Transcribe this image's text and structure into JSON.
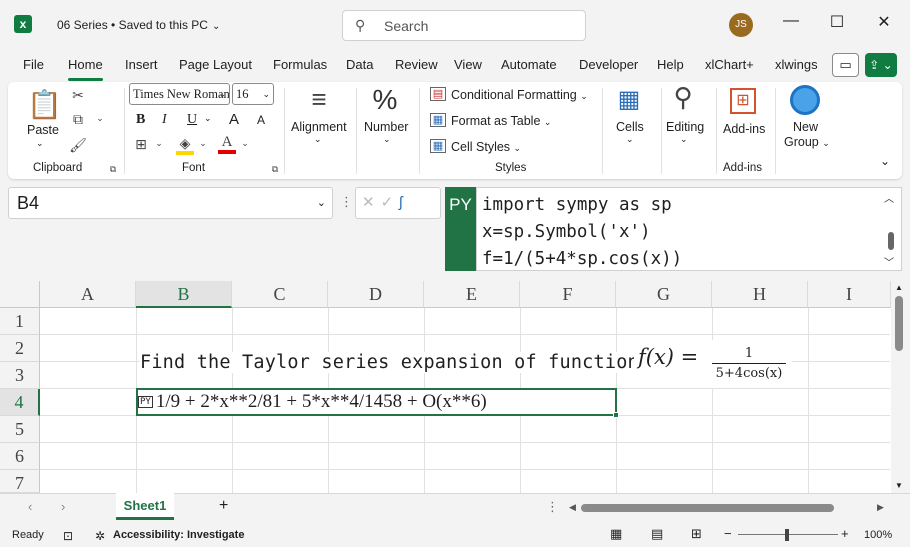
{
  "window": {
    "title": "06 Series • Saved to this PC",
    "search_placeholder": "Search",
    "user_initials": "JS",
    "minimize": "—",
    "maximize": "☐",
    "close": "✕"
  },
  "menu": [
    "File",
    "Home",
    "Insert",
    "Page Layout",
    "Formulas",
    "Data",
    "Review",
    "View",
    "Automate",
    "Developer",
    "Help",
    "xlChart+",
    "xlwings"
  ],
  "active_menu": "Home",
  "ribbon": {
    "clipboard": {
      "paste": "Paste",
      "label": "Clipboard"
    },
    "font": {
      "family": "Times New Roman",
      "size": "16",
      "label": "Font",
      "bold": "B",
      "italic": "I",
      "underline": "U",
      "grow": "A",
      "shrink": "A"
    },
    "alignment": {
      "label": "Alignment"
    },
    "number": {
      "label": "Number",
      "symbol": "%"
    },
    "styles": {
      "conditional": "Conditional Formatting",
      "table": "Format as Table",
      "cell_styles": "Cell Styles",
      "label": "Styles"
    },
    "cells": {
      "label": "Cells"
    },
    "editing": {
      "label": "Editing"
    },
    "addins": {
      "button": "Add-ins",
      "label": "Add-ins"
    },
    "newgroup": {
      "line1": "New",
      "line2": "Group"
    }
  },
  "formula_bar": {
    "name_box": "B4",
    "py_flag": "PY",
    "lines": [
      "import sympy as sp",
      "x=sp.Symbol('x')",
      "f=1/(5+4*sp.cos(x))"
    ]
  },
  "columns": [
    "A",
    "B",
    "C",
    "D",
    "E",
    "F",
    "G",
    "H",
    "I"
  ],
  "rows": [
    "1",
    "2",
    "3",
    "4",
    "5",
    "6",
    "7"
  ],
  "selected_column": "B",
  "selected_row": "4",
  "cells": {
    "B2": "Find the Taylor series expansion of function",
    "B4_icon": "PY",
    "B4": "1/9 + 2*x**2/81 + 5*x**4/1458 + O(x**6)"
  },
  "formula_image": {
    "lhs": "f(x) =",
    "numerator": "1",
    "denominator": "5+4cos(x)"
  },
  "sheets": [
    "Sheet1"
  ],
  "status": {
    "ready": "Ready",
    "accessibility": "Accessibility: Investigate",
    "zoom": "100%"
  }
}
